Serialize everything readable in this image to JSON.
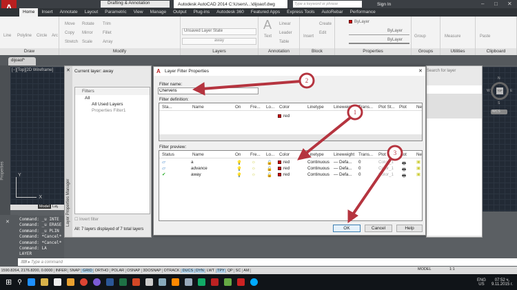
{
  "titlebar": {
    "workspace": "Drafting & Annotation",
    "title": "Autodesk AutoCAD 2014   C:\\Users\\...\\dijoaof.dwg",
    "search_placeholder": "Type a keyword or phrase",
    "sign_in": "Sign In"
  },
  "tabs": [
    "Home",
    "Insert",
    "Annotate",
    "Layout",
    "Parametric",
    "View",
    "Manage",
    "Output",
    "Plug-ins",
    "Autodesk 360",
    "Featured Apps",
    "Express Tools",
    "AutoRebar",
    "Performance"
  ],
  "ribbon": {
    "draw": {
      "label": "Draw",
      "tools": [
        "Line",
        "Polyline",
        "Circle",
        "Arc"
      ]
    },
    "modify": {
      "label": "Modify",
      "tools": [
        "Move",
        "Rotate",
        "Trim",
        "Copy",
        "Mirror",
        "Fillet",
        "Stretch",
        "Scale",
        "Array"
      ]
    },
    "layers": {
      "label": "Layers",
      "state": "Unsaved Layer State",
      "layer": "away"
    },
    "annotation": {
      "label": "Annotation",
      "tools": [
        "Text",
        "Linear",
        "Leader",
        "Table"
      ]
    },
    "block": {
      "label": "Block",
      "tools": [
        "Insert",
        "Create",
        "Edit"
      ]
    },
    "properties": {
      "label": "Properties",
      "color": "ByLayer",
      "linetype": "ByLayer",
      "lineweight": "ByLayer"
    },
    "groups": {
      "label": "Groups",
      "tool": "Group"
    },
    "utilities": {
      "label": "Utilities",
      "tool": "Measure"
    },
    "clipboard": {
      "label": "Clipboard",
      "tool": "Paste"
    }
  },
  "doc_tab": "dijoaof*",
  "viewport": {
    "label": "[−][Top][2D Wireframe]",
    "tabs": [
      "Model",
      "Layout1"
    ],
    "compass": [
      "N",
      "S",
      "W",
      "E",
      "TOP"
    ],
    "wcs": "WCS"
  },
  "properties_palette": "Properties",
  "layer_manager": {
    "title": "Layer Properties Manager",
    "current_layer": "Current layer: away",
    "filters_header": "Filters",
    "tree": [
      "All",
      "All Used Layers",
      "Properties Filter1"
    ],
    "invert_filter": "Invert filter",
    "summary": "All: 7 layers displayed of 7 total layers",
    "search_placeholder": "Search for layer"
  },
  "dialog": {
    "title": "Layer Filter Properties",
    "filter_name_label": "Filter name:",
    "filter_name": "Chervens",
    "definition_label": "Filter definition:",
    "definition_columns": [
      "Sta...",
      "Name",
      "On",
      "Fre...",
      "Lo...",
      "Color",
      "Linetype",
      "Lineweight",
      "Trans...",
      "Plot St...",
      "Plot",
      "Ne"
    ],
    "definition_row": {
      "color": "red"
    },
    "preview_label": "Filter preview:",
    "preview_columns": [
      "Status",
      "Name",
      "On",
      "Fre...",
      "Lo...",
      "Color",
      "Linetype",
      "Lineweight",
      "Trans...",
      "Plot St...",
      "Plot",
      "Ne"
    ],
    "preview_rows": [
      {
        "name": "a",
        "color": "red",
        "linetype": "Continuous",
        "lineweight": "Defa...",
        "trans": "0",
        "plotstyle": "Color_1"
      },
      {
        "name": "advance",
        "color": "red",
        "linetype": "Continuous",
        "lineweight": "Defa...",
        "trans": "0",
        "plotstyle": "Color_1"
      },
      {
        "name": "away",
        "color": "red",
        "linetype": "Continuous",
        "lineweight": "Defa...",
        "trans": "0",
        "plotstyle": "Color_1"
      }
    ],
    "ok": "OK",
    "cancel": "Cancel",
    "help": "Help"
  },
  "annotations": [
    "1",
    "2",
    "3"
  ],
  "command_history": [
    "Command: _u INTE",
    "Command: _u ERASE",
    "Command: _u PLIN",
    "Command: *Cancel*",
    "Command: *Cancel*",
    "Command: LA",
    "LAYER"
  ],
  "command_placeholder": "Type a command",
  "status": {
    "coords": "1590.8264, 2176.8200, 0.0000",
    "toggles": [
      {
        "l": "INFER",
        "on": false
      },
      {
        "l": "SNAP",
        "on": false
      },
      {
        "l": "GRID",
        "on": true
      },
      {
        "l": "ORTHO",
        "on": false
      },
      {
        "l": "POLAR",
        "on": false
      },
      {
        "l": "OSNAP",
        "on": false
      },
      {
        "l": "3DOSNAP",
        "on": false
      },
      {
        "l": "OTRACK",
        "on": false
      },
      {
        "l": "DUCS",
        "on": true
      },
      {
        "l": "DYN",
        "on": true
      },
      {
        "l": "LWT",
        "on": false
      },
      {
        "l": "TPY",
        "on": true
      },
      {
        "l": "QP",
        "on": false
      },
      {
        "l": "SC",
        "on": false
      },
      {
        "l": "AM",
        "on": false
      }
    ],
    "model": "MODEL",
    "scale": "1:1"
  },
  "taskbar": {
    "lang": "ENG",
    "region": "US",
    "time": "07:52 ч.",
    "date": "9.11.2015 г."
  },
  "colors": {
    "accent": "#b5343f",
    "layer_red": "#cc0000"
  }
}
